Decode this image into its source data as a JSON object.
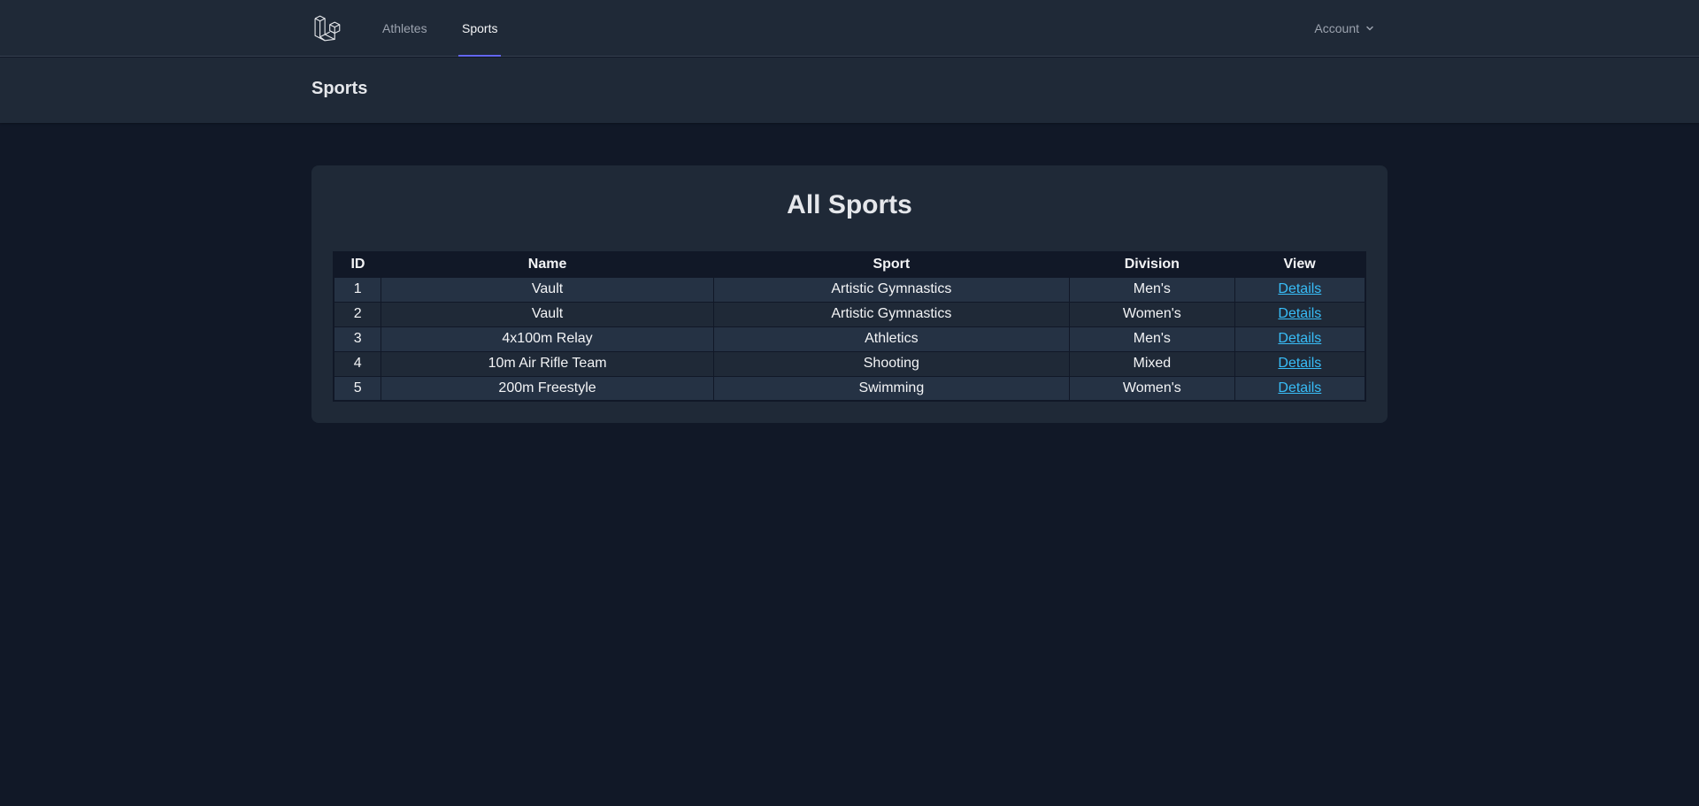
{
  "nav": {
    "links": [
      {
        "label": "Athletes",
        "active": false
      },
      {
        "label": "Sports",
        "active": true
      }
    ],
    "account_label": "Account"
  },
  "header": {
    "title": "Sports"
  },
  "main": {
    "card_title": "All Sports",
    "table": {
      "columns": [
        "ID",
        "Name",
        "Sport",
        "Division",
        "View"
      ],
      "rows": [
        {
          "id": "1",
          "name": "Vault",
          "sport": "Artistic Gymnastics",
          "division": "Men's",
          "view": "Details"
        },
        {
          "id": "2",
          "name": "Vault",
          "sport": "Artistic Gymnastics",
          "division": "Women's",
          "view": "Details"
        },
        {
          "id": "3",
          "name": "4x100m Relay",
          "sport": "Athletics",
          "division": "Men's",
          "view": "Details"
        },
        {
          "id": "4",
          "name": "10m Air Rifle Team",
          "sport": "Shooting",
          "division": "Mixed",
          "view": "Details"
        },
        {
          "id": "5",
          "name": "200m Freestyle",
          "sport": "Swimming",
          "division": "Women's",
          "view": "Details"
        }
      ]
    }
  },
  "colors": {
    "background": "#111827",
    "surface": "#1f2937",
    "accent": "#6366f1",
    "link": "#38bdf8"
  },
  "icons": {
    "logo": "laravel-logo-icon",
    "dropdown": "chevron-down-icon"
  }
}
